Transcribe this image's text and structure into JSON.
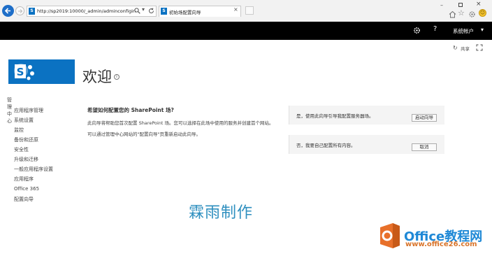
{
  "browser": {
    "url": "http://sp2019:10000/_admin/adminconfigin",
    "tab_title": "初始场配置向导"
  },
  "suite_bar": {
    "account_label": "系统帐户"
  },
  "toolbar": {
    "share_label": "共享"
  },
  "page": {
    "title": "欢迎"
  },
  "quick_launch": {
    "heading": "管理中心",
    "items": [
      {
        "label": "应用程序管理"
      },
      {
        "label": "系统设置"
      },
      {
        "label": "监控"
      },
      {
        "label": "备份和还原"
      },
      {
        "label": "安全性"
      },
      {
        "label": "升级和迁移"
      },
      {
        "label": "一般应用程序设置"
      },
      {
        "label": "应用程序"
      },
      {
        "label": "Office 365"
      },
      {
        "label": "配置向导"
      }
    ]
  },
  "main": {
    "question": "希望如何配置您的 SharePoint 场?",
    "paragraph1": "此向导将帮助您首次配置 SharePoint 场。您可以选择在此场中使用的服务并创建首个网站。",
    "paragraph2": "可以通过管理中心网站的\"配置向导\"页重新启动此向导。"
  },
  "options": [
    {
      "text": "是，使用此向导引导我配置服务器场。",
      "button": "启动向导"
    },
    {
      "text": "否，我要自己配置所有内容。",
      "button": "取消"
    }
  ],
  "watermark": {
    "text": "霖雨制作"
  },
  "office_logo": {
    "name": "Office教程网",
    "url": "www.office26.com"
  }
}
